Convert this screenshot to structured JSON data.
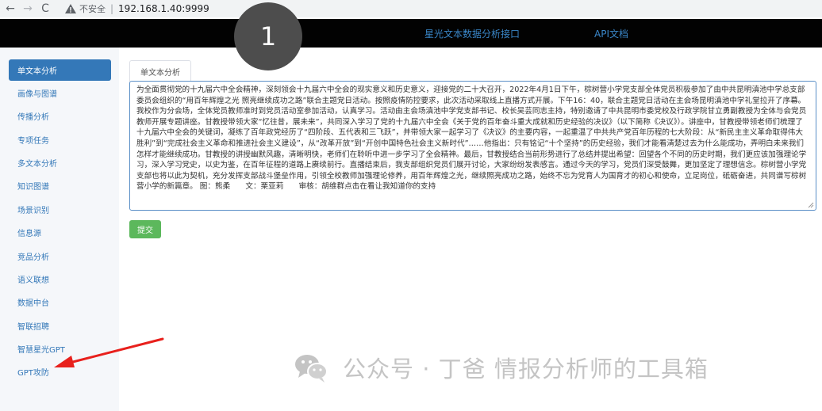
{
  "browser": {
    "back_icon": "←",
    "forward_icon": "→",
    "reload_icon": "C",
    "security_label": "不安全",
    "separator": "|",
    "url": "192.168.1.40:9999"
  },
  "navbar": {
    "brand": "星光文本数据分析接口",
    "api_docs": "API文档"
  },
  "badge": {
    "number": "1"
  },
  "sidebar": {
    "items": [
      {
        "label": "单文本分析",
        "active": true
      },
      {
        "label": "画像与图谱"
      },
      {
        "label": "传播分析"
      },
      {
        "label": "专项任务"
      },
      {
        "label": "多文本分析"
      },
      {
        "label": "知识图谱"
      },
      {
        "label": "场景识别"
      },
      {
        "label": "信息源"
      },
      {
        "label": "竞品分析"
      },
      {
        "label": "语义联想"
      },
      {
        "label": "数据中台"
      },
      {
        "label": "智联招聘"
      },
      {
        "label": "智慧星光GPT"
      },
      {
        "label": "GPT攻防"
      }
    ]
  },
  "main": {
    "tab_label": "单文本分析",
    "input_text": "为全面贯彻党的十九届六中全会精神，深刻领会十九届六中全会的现实意义和历史意义，迎接党的二十大召开，2022年4月1日下午，棕树营小学党支部全体党员积极参加了由中共昆明滇池中学总支部委员会组织的“用百年辉煌之光 照亮继续成功之路”联合主题党日活动。按照疫情防控要求，此次活动采取线上直播方式开展。下午16：40，联合主题党日活动在主会场昆明滇池中学礼堂拉开了序幕。我校作为分会场，全体党员教师准时到党员活动室参加活动，认真学习。活动由主会场滇池中学党支部书记、校长吴芸同志主持，特别邀请了中共昆明市委党校及行政学院甘立勇副教授为全体与会党员教师开展专题讲座。甘教授带领大家“忆往昔，展未来”，共同深入学习了党的十九届六中全会《关于党的百年奋斗重大成就和历史经验的决议》（以下简称《决议》）。讲座中，甘教授带领老师们梳理了十九届六中全会的关键词，凝练了百年政党经历了“四阶段、五代表和三飞跃”，并带领大家一起学习了《决议》的主要内容，一起重温了中共共产党百年历程的七大阶段：从“新民主主义革命取得伟大胜利”到“完成社会主义革命和推进社会主义建设”，从“改革开放”到“开创中国特色社会主义新时代”……他指出：只有铭记“十个坚持”的历史经验，我们才能看清楚过去为什么能成功，弄明白未来我们怎样才能继续成功。甘教授的讲授幽默风趣，清晰明快，老师们在聆听中进一步学习了全会精神。最后，甘教授结合当前形势进行了总结并提出希望：回望各个不同的历史时期，我们更应该加强理论学习，深入学习党史，以史为鉴，在百年征程的道路上赓续前行。直播结束后，我支部组织党员们展开讨论，大家纷纷发表感言。通过今天的学习，党员们深受鼓舞，更加坚定了理想信念。棕树营小学党支部也将以此为契机，充分发挥支部战斗堡垒作用，引领全校教师加强理论修养，用百年辉煌之光，继续照亮成功之路，始终不忘为党育人为国育才的初心和使命，立足岗位，砥砺奋进，共同谱写棕树营小学的新篇章。 图：熊柔　　文：栗亚莉　　审核：胡维群点击在看让我知道你的支持",
    "submit_label": "提交"
  },
  "watermark": {
    "text": "公众号 · 丁爸 情报分析师的工具箱",
    "icon": "wechat-icon"
  },
  "colors": {
    "navbar_bg": "#020202",
    "link": "#3a87c9",
    "sidebar_active": "#3478b8",
    "submit": "#5cb85c",
    "arrow": "#e8201c"
  }
}
